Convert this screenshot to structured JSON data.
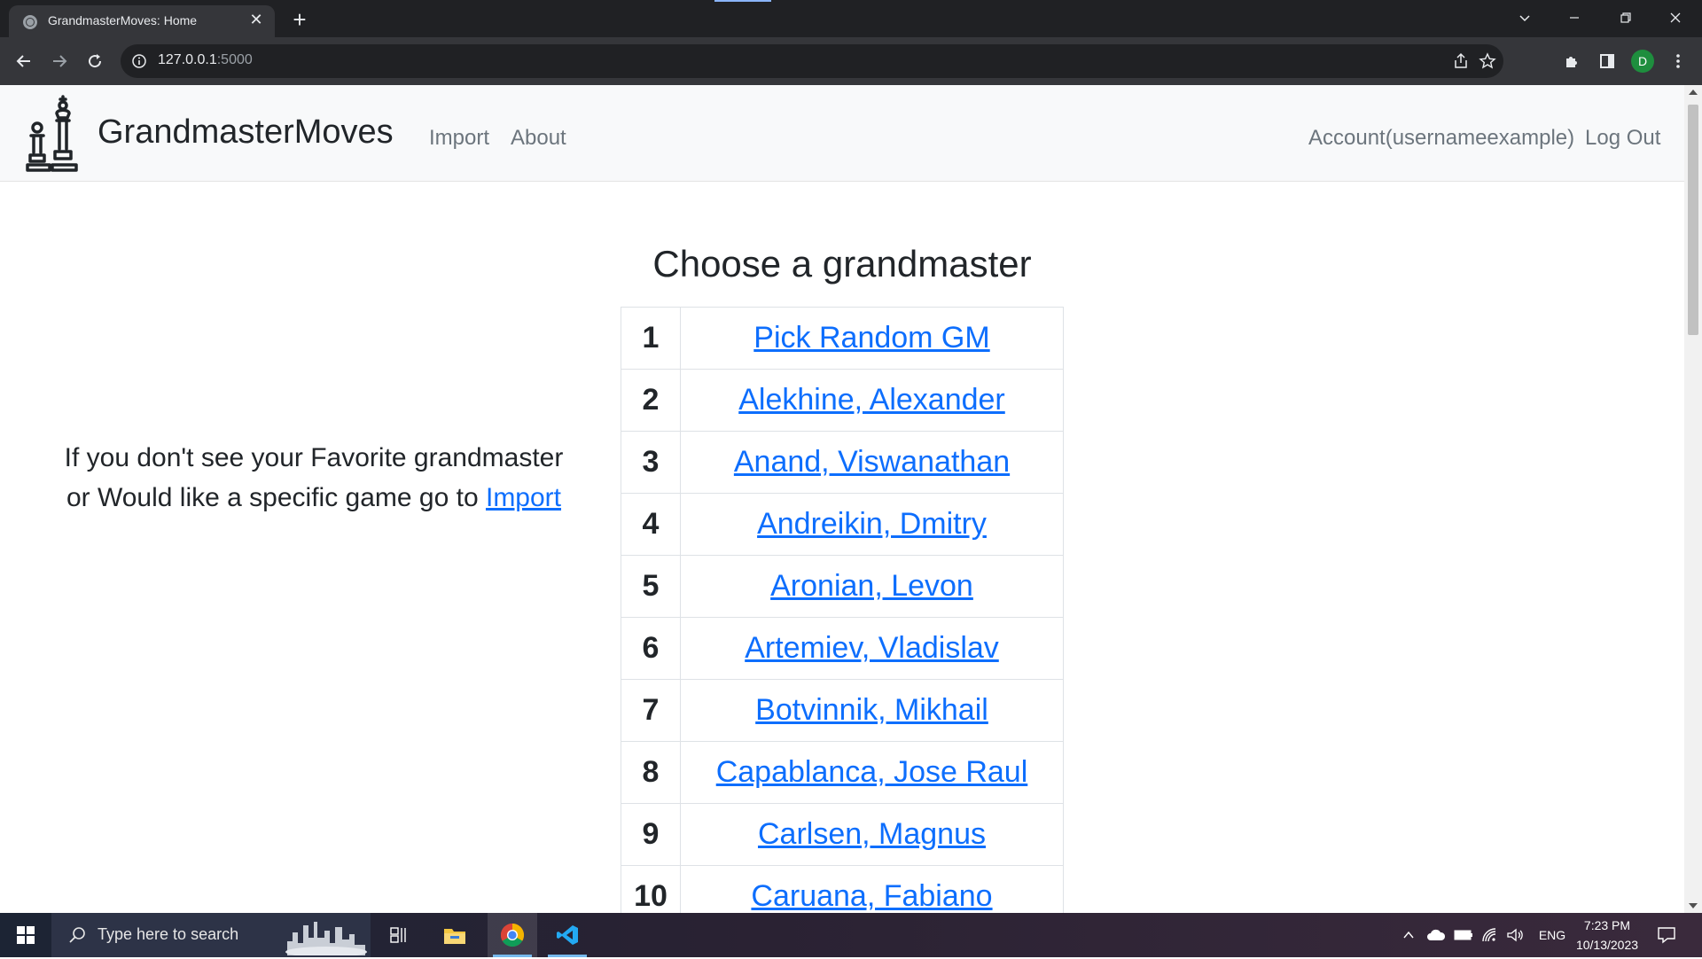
{
  "browser": {
    "tab_title": "GrandmasterMoves: Home",
    "tab_close": "✕",
    "new_tab": "+",
    "url_host": "127.0.0.1",
    "url_port": ":5000",
    "profile_initial": "D"
  },
  "navbar": {
    "brand": "GrandmasterMoves",
    "links": [
      "Import",
      "About"
    ],
    "account": "Account(usernameexample)",
    "logout": "Log Out"
  },
  "main": {
    "heading": "Choose a grandmaster",
    "side_note_prefix": "If you don't see your Favorite grandmaster or Would like a specific game go to ",
    "side_note_link": "Import",
    "rows": [
      {
        "num": "1",
        "name": "Pick Random GM"
      },
      {
        "num": "2",
        "name": "Alekhine, Alexander"
      },
      {
        "num": "3",
        "name": "Anand, Viswanathan"
      },
      {
        "num": "4",
        "name": "Andreikin, Dmitry"
      },
      {
        "num": "5",
        "name": "Aronian, Levon"
      },
      {
        "num": "6",
        "name": "Artemiev, Vladislav"
      },
      {
        "num": "7",
        "name": "Botvinnik, Mikhail"
      },
      {
        "num": "8",
        "name": "Capablanca, Jose Raul"
      },
      {
        "num": "9",
        "name": "Carlsen, Magnus"
      },
      {
        "num": "10",
        "name": "Caruana, Fabiano"
      }
    ]
  },
  "taskbar": {
    "search_placeholder": "Type here to search",
    "language": "ENG",
    "time": "7:23 PM",
    "date": "10/13/2023"
  },
  "colors": {
    "link": "#0d6efd",
    "navbar_bg": "#f8f9fa",
    "chrome_dark": "#202124",
    "chrome_toolbar": "#35363a"
  }
}
